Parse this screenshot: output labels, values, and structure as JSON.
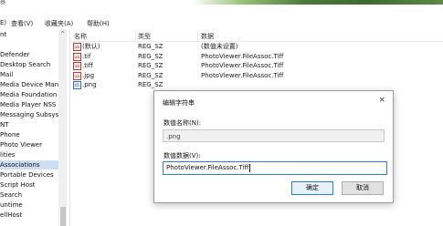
{
  "window": {
    "title": "器"
  },
  "menu": [
    "E)",
    "查看(V)",
    "收藏夹(A)",
    "帮助(H)"
  ],
  "tree": {
    "items": [
      "nt",
      "",
      "Defender",
      "Desktop Search",
      "Mail",
      "Media Device Man",
      "Media Foundation",
      "Media Player NSS",
      "Messaging Subsyst",
      "NT",
      "Phone",
      "Photo Viewer",
      "lities",
      "Associations",
      "Portable Devices",
      "Script Host",
      "Search",
      "untime",
      "ellHost"
    ],
    "selected_index": 13
  },
  "list": {
    "columns": [
      "名称",
      "类型",
      "数据"
    ],
    "rows": [
      {
        "icon": "string-value-icon",
        "name": "(默认)",
        "type": "REG_SZ",
        "data": "(数值未设置)"
      },
      {
        "icon": "string-value-icon",
        "name": ".tif",
        "type": "REG_SZ",
        "data": "PhotoViewer.FileAssoc.Tiff"
      },
      {
        "icon": "string-value-icon",
        "name": ".tiff",
        "type": "REG_SZ",
        "data": "PhotoViewer.FileAssoc.Tiff"
      },
      {
        "icon": "string-value-icon",
        "name": ".jpg",
        "type": "REG_SZ",
        "data": "PhotoViewer.FileAssoc.Tiff"
      },
      {
        "icon": "binary-value-icon",
        "name": ".png",
        "type": "REG_SZ",
        "data": ""
      }
    ]
  },
  "dialog": {
    "title": "编辑字符串",
    "close": "×",
    "name_label": "数值名称(N):",
    "name_value": ".png",
    "data_label": "数值数据(V):",
    "data_value": "PhotoViewer.FileAssoc.Tiff",
    "ok": "确定",
    "cancel": "取消"
  }
}
